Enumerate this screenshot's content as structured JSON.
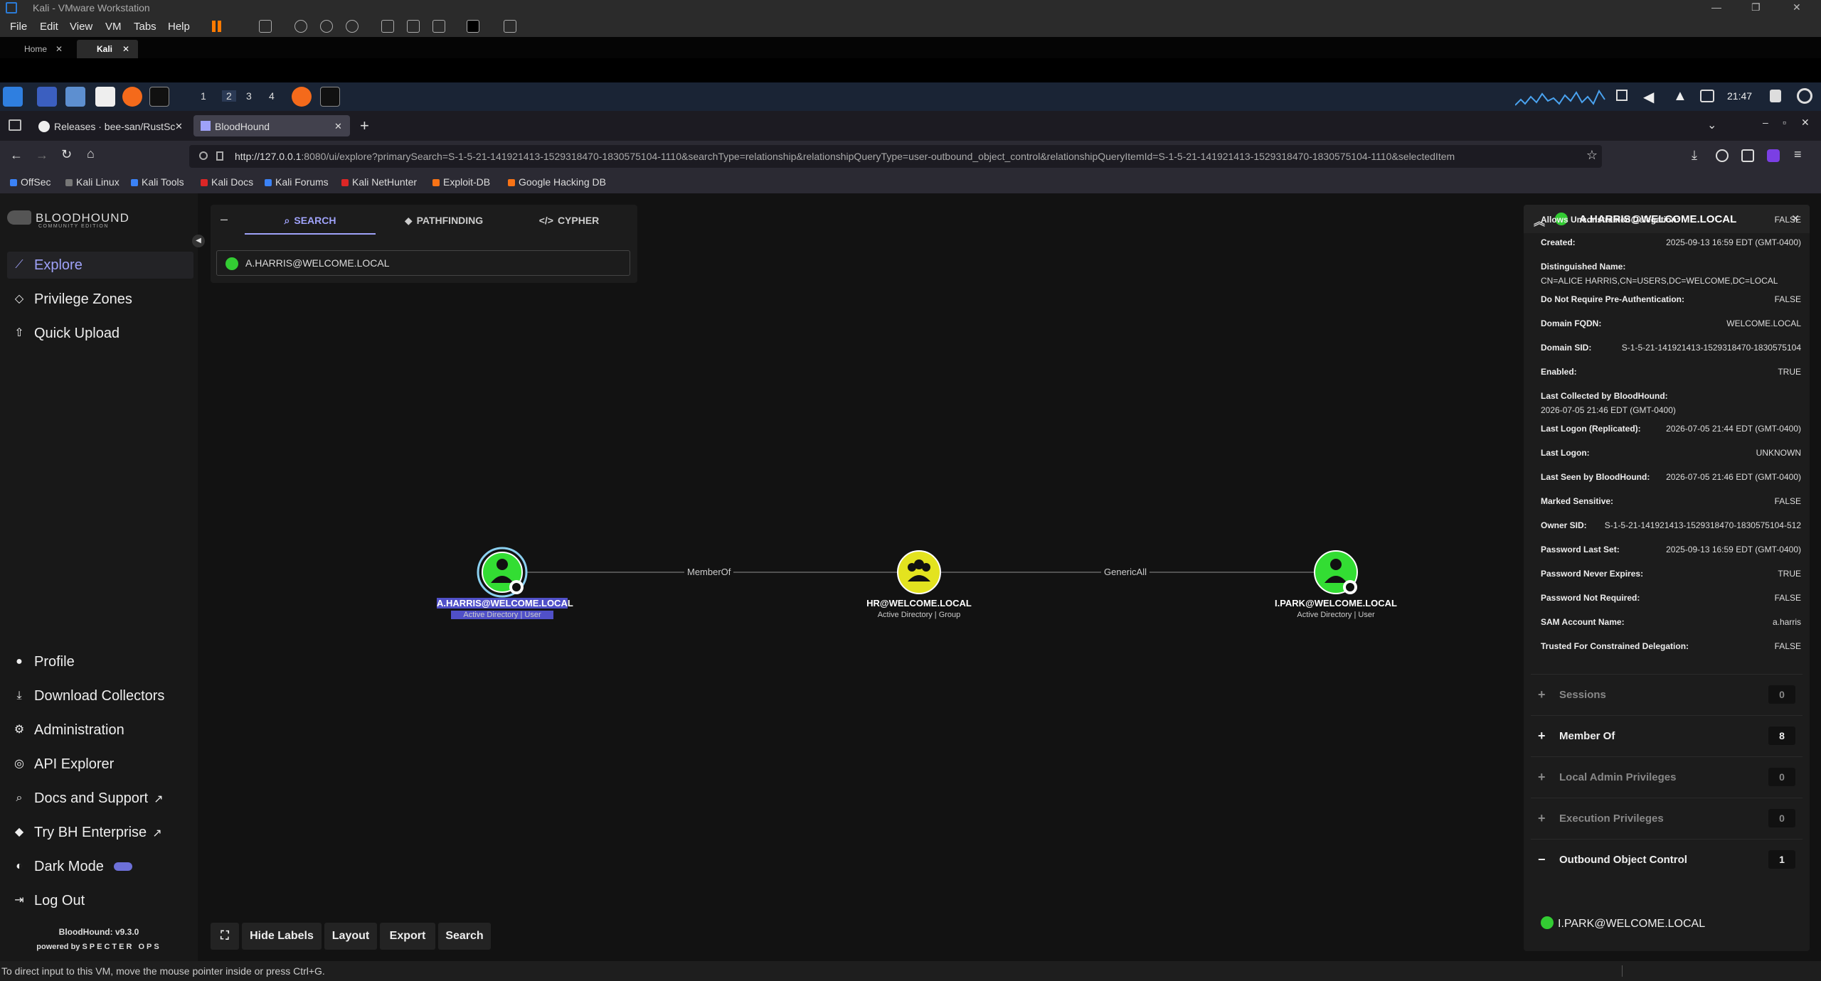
{
  "vmware": {
    "title": "Kali - VMware Workstation",
    "menu": [
      "File",
      "Edit",
      "View",
      "VM",
      "Tabs",
      "Help"
    ],
    "tabs": [
      {
        "label": "Home"
      },
      {
        "label": "Kali"
      }
    ]
  },
  "kali_panel": {
    "workspaces": [
      "1",
      "2",
      "3",
      "4"
    ],
    "clock": "21:47"
  },
  "firefox": {
    "tabs": [
      {
        "label": "Releases · bee-san/RustSc"
      },
      {
        "label": "BloodHound"
      }
    ],
    "url_host": "http://127.0.0.1",
    "url_rest": ":8080/ui/explore?primarySearch=S-1-5-21-141921413-1529318470-1830575104-1110&searchType=relationship&relationshipQueryType=user-outbound_object_control&relationshipQueryItemId=S-1-5-21-141921413-1529318470-1830575104-1110&selectedItem",
    "bookmarks": [
      {
        "label": "OffSec",
        "color": "#3b82f6"
      },
      {
        "label": "Kali Linux",
        "color": "#777777"
      },
      {
        "label": "Kali Tools",
        "color": "#3b82f6"
      },
      {
        "label": "Kali Docs",
        "color": "#dc2626"
      },
      {
        "label": "Kali Forums",
        "color": "#3b82f6"
      },
      {
        "label": "Kali NetHunter",
        "color": "#dc2626"
      },
      {
        "label": "Exploit-DB",
        "color": "#f97316"
      },
      {
        "label": "Google Hacking DB",
        "color": "#f97316"
      }
    ]
  },
  "sidebar": {
    "logo": "BLOODHOUND",
    "logo_sub": "COMMUNITY EDITION",
    "top_items": [
      {
        "label": "Explore"
      },
      {
        "label": "Privilege Zones"
      },
      {
        "label": "Quick Upload"
      }
    ],
    "bottom_items": [
      {
        "label": "Profile"
      },
      {
        "label": "Download Collectors"
      },
      {
        "label": "Administration"
      },
      {
        "label": "API Explorer"
      },
      {
        "label": "Docs and Support"
      },
      {
        "label": "Try BH Enterprise"
      },
      {
        "label": "Dark Mode"
      },
      {
        "label": "Log Out"
      }
    ],
    "version": "BloodHound: v9.3.0",
    "powered_by": "powered by",
    "powered_brand": "SPECTER OPS"
  },
  "search": {
    "tabs": [
      {
        "label": "SEARCH"
      },
      {
        "label": "PATHFINDING"
      },
      {
        "label": "CYPHER"
      }
    ],
    "value": "A.HARRIS@WELCOME.LOCAL"
  },
  "graph": {
    "nodes": [
      {
        "label": "A.HARRIS@WELCOME.LOCAL",
        "sub": "Active Directory | User",
        "kind": "user",
        "color": "#33dd33"
      },
      {
        "label": "HR@WELCOME.LOCAL",
        "sub": "Active Directory | Group",
        "kind": "group",
        "color": "#e3e31f"
      },
      {
        "label": "I.PARK@WELCOME.LOCAL",
        "sub": "Active Directory | User",
        "kind": "user",
        "color": "#33dd33"
      }
    ],
    "edges": [
      {
        "label": "MemberOf"
      },
      {
        "label": "GenericAll"
      }
    ],
    "buttons": [
      {
        "label": "Hide Labels"
      },
      {
        "label": "Layout"
      },
      {
        "label": "Export"
      },
      {
        "label": "Search"
      }
    ]
  },
  "entity": {
    "title": "A.HARRIS@WELCOME.LOCAL",
    "properties": [
      {
        "k": "Allows Unconstrained Delegation:",
        "v": "FALSE"
      },
      {
        "k": "Created:",
        "v": "2025-09-13 16:59 EDT (GMT-0400)"
      },
      {
        "k": "Distinguished Name:",
        "v": "CN=ALICE HARRIS,CN=USERS,DC=WELCOME,DC=LOCAL",
        "wrap": true
      },
      {
        "k": "Do Not Require Pre-Authentication:",
        "v": "FALSE"
      },
      {
        "k": "Domain FQDN:",
        "v": "WELCOME.LOCAL"
      },
      {
        "k": "Domain SID:",
        "v": "S-1-5-21-141921413-1529318470-1830575104"
      },
      {
        "k": "Enabled:",
        "v": "TRUE"
      },
      {
        "k": "Last Collected by BloodHound:",
        "v": "2026-07-05 21:46 EDT (GMT-0400)",
        "wrap": true
      },
      {
        "k": "Last Logon (Replicated):",
        "v": "2026-07-05 21:44 EDT (GMT-0400)"
      },
      {
        "k": "Last Logon:",
        "v": "UNKNOWN"
      },
      {
        "k": "Last Seen by BloodHound:",
        "v": "2026-07-05 21:46 EDT (GMT-0400)"
      },
      {
        "k": "Marked Sensitive:",
        "v": "FALSE"
      },
      {
        "k": "Owner SID:",
        "v": "S-1-5-21-141921413-1529318470-1830575104-512"
      },
      {
        "k": "Password Last Set:",
        "v": "2025-09-13 16:59 EDT (GMT-0400)"
      },
      {
        "k": "Password Never Expires:",
        "v": "TRUE"
      },
      {
        "k": "Password Not Required:",
        "v": "FALSE"
      },
      {
        "k": "SAM Account Name:",
        "v": "a.harris"
      },
      {
        "k": "Trusted For Constrained Delegation:",
        "v": "FALSE"
      }
    ],
    "sections": [
      {
        "label": "Sessions",
        "count": "0",
        "dim": true,
        "sign": "+"
      },
      {
        "label": "Member Of",
        "count": "8",
        "dim": false,
        "sign": "+"
      },
      {
        "label": "Local Admin Privileges",
        "count": "0",
        "dim": true,
        "sign": "+"
      },
      {
        "label": "Execution Privileges",
        "count": "0",
        "dim": true,
        "sign": "+"
      },
      {
        "label": "Outbound Object Control",
        "count": "1",
        "dim": false,
        "sign": "−"
      }
    ],
    "outbound_item": "I.PARK@WELCOME.LOCAL"
  },
  "status": "To direct input to this VM, move the mouse pointer inside or press Ctrl+G."
}
